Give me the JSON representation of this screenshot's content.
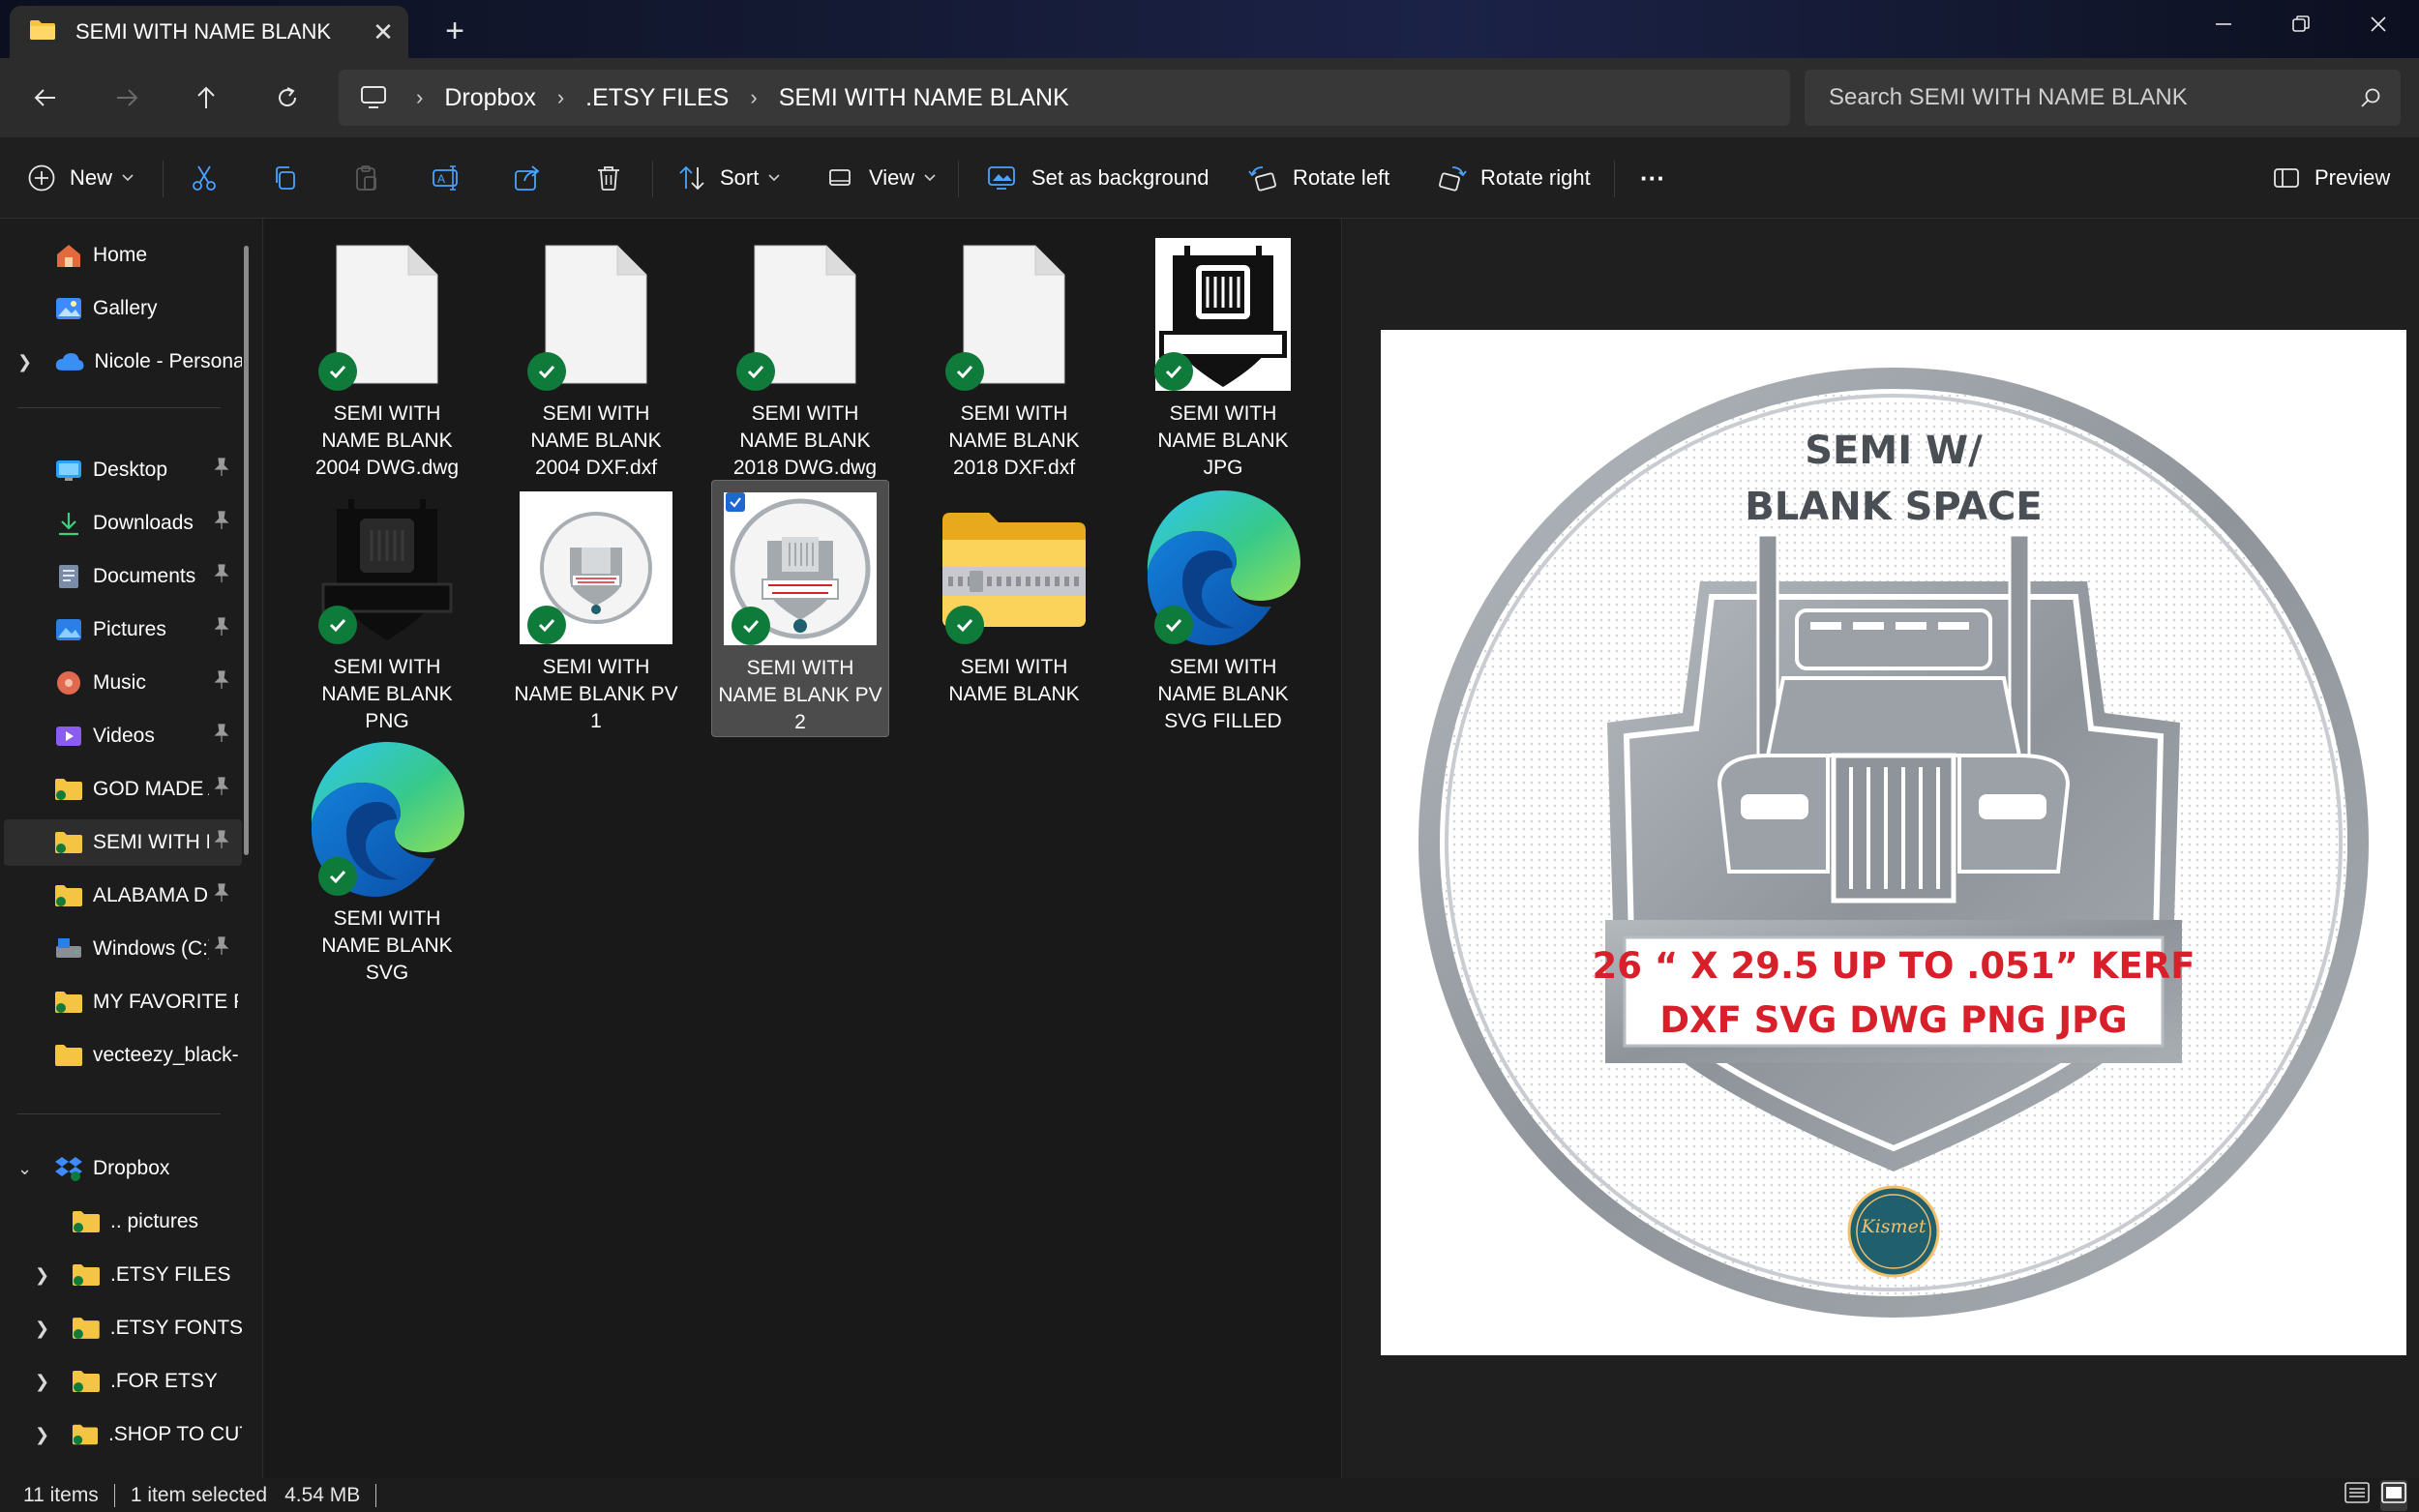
{
  "window": {
    "tab_title": "SEMI WITH NAME BLANK",
    "new_tab": "+",
    "close_tab": "✕"
  },
  "address": {
    "crumbs": [
      "Dropbox",
      ".ETSY FILES",
      "SEMI WITH NAME BLANK"
    ],
    "separator": "›"
  },
  "search": {
    "placeholder": "Search SEMI WITH NAME BLANK"
  },
  "toolbar": {
    "new_label": "New",
    "sort_label": "Sort",
    "view_label": "View",
    "set_background_label": "Set as background",
    "rotate_left_label": "Rotate left",
    "rotate_right_label": "Rotate right",
    "more_label": "···",
    "preview_label": "Preview"
  },
  "sidebar": {
    "home": "Home",
    "gallery": "Gallery",
    "onedrive": "Nicole - Persona",
    "quick_access": [
      {
        "label": "Desktop",
        "icon": "desktop-icon"
      },
      {
        "label": "Downloads",
        "icon": "download-icon"
      },
      {
        "label": "Documents",
        "icon": "documents-icon"
      },
      {
        "label": "Pictures",
        "icon": "pictures-icon"
      },
      {
        "label": "Music",
        "icon": "music-icon"
      },
      {
        "label": "Videos",
        "icon": "videos-icon"
      },
      {
        "label": "GOD MADE A",
        "icon": "folder-icon"
      },
      {
        "label": "SEMI WITH N",
        "icon": "folder-icon"
      },
      {
        "label": "ALABAMA DE",
        "icon": "folder-icon"
      },
      {
        "label": "Windows (C:)",
        "icon": "drive-icon"
      },
      {
        "label": "MY FAVORITE PE",
        "icon": "folder-icon"
      },
      {
        "label": "vecteezy_black-s",
        "icon": "folder-icon"
      }
    ],
    "dropbox": "Dropbox",
    "dropbox_children": [
      ".. pictures",
      ".ETSY FILES",
      ".ETSY FONTS",
      ".FOR ETSY",
      ".SHOP TO CUT"
    ]
  },
  "files": [
    {
      "name": "SEMI WITH NAME BLANK 2004 DWG.dwg",
      "kind": "doc-icon"
    },
    {
      "name": "SEMI WITH NAME BLANK 2004 DXF.dxf",
      "kind": "doc-icon"
    },
    {
      "name": "SEMI WITH NAME BLANK 2018 DWG.dwg",
      "kind": "doc-icon"
    },
    {
      "name": "SEMI WITH NAME BLANK 2018 DXF.dxf",
      "kind": "doc-icon"
    },
    {
      "name": "SEMI WITH NAME BLANK JPG",
      "kind": "truck-thumb"
    },
    {
      "name": "SEMI WITH NAME BLANK PNG",
      "kind": "truck-thumb-dark"
    },
    {
      "name": "SEMI WITH NAME BLANK PV 1",
      "kind": "round-thumb"
    },
    {
      "name": "SEMI WITH NAME BLANK PV 2",
      "kind": "round-thumb"
    },
    {
      "name": "SEMI WITH NAME BLANK",
      "kind": "zip-folder-icon"
    },
    {
      "name": "SEMI WITH NAME BLANK SVG FILLED",
      "kind": "edge-icon"
    },
    {
      "name": "SEMI WITH NAME BLANK SVG",
      "kind": "edge-icon"
    }
  ],
  "preview": {
    "title_line1": "SEMI W/",
    "title_line2": "BLANK SPACE",
    "banner_line1": "26 “ X 29.5  UP TO .051” KERF",
    "banner_line2": "DXF SVG DWG PNG JPG",
    "logo_text": "Kismet",
    "accent_red": "#d8202a",
    "metal_gray": "#9aa0a6"
  },
  "status": {
    "item_count": "11 items",
    "selection": "1 item selected",
    "size": "4.54 MB"
  },
  "colors": {
    "check_green": "#0f7b3b",
    "folder_yellow": "#f4c542",
    "dropbox_blue": "#3d8bff"
  }
}
